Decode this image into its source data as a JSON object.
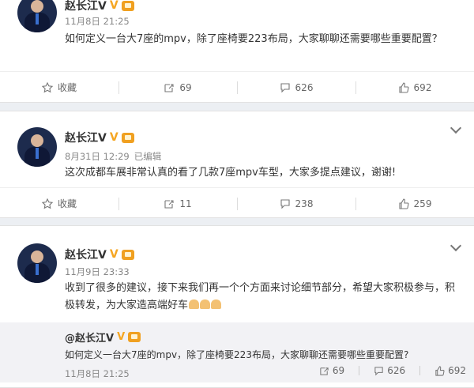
{
  "posts": [
    {
      "author": "赵长江V",
      "verified": "V",
      "time": "11月8日 21:25",
      "edited": "",
      "text": "如何定义一台大7座的mpv，除了座椅要223布局，大家聊聊还需要哪些重要配置？",
      "actions": {
        "collect": "收藏",
        "repost": "69",
        "comment": "626",
        "like": "692"
      }
    },
    {
      "author": "赵长江V",
      "verified": "V",
      "time": "8月31日 12:29",
      "edited": "已编辑",
      "text": "这次成都车展非常认真的看了几款7座mpv车型，大家多提点建议，谢谢!",
      "actions": {
        "collect": "收藏",
        "repost": "11",
        "comment": "238",
        "like": "259"
      }
    },
    {
      "author": "赵长江V",
      "verified": "V",
      "time": "11月9日 23:33",
      "edited": "",
      "text": "收到了很多的建议，接下来我们再一个个方面来讨论细节部分，希望大家积极参与，积极转发，为大家造高端好车",
      "repost": {
        "author": "@赵长江V",
        "verified": "V",
        "text": "如何定义一台大7座的mpv，除了座椅要223布局，大家聊聊还需要哪些重要配置?",
        "time": "11月8日 21:25",
        "repost_count": "69",
        "comment_count": "626",
        "like_count": "692"
      }
    }
  ],
  "icons": {
    "collect": "star-icon",
    "repost": "repost-icon",
    "comment": "comment-icon",
    "like": "thumbs-up-icon",
    "more": "chevron-down-icon"
  },
  "colors": {
    "accent": "#f5a623",
    "muted": "#888888",
    "background": "#eceff3"
  }
}
